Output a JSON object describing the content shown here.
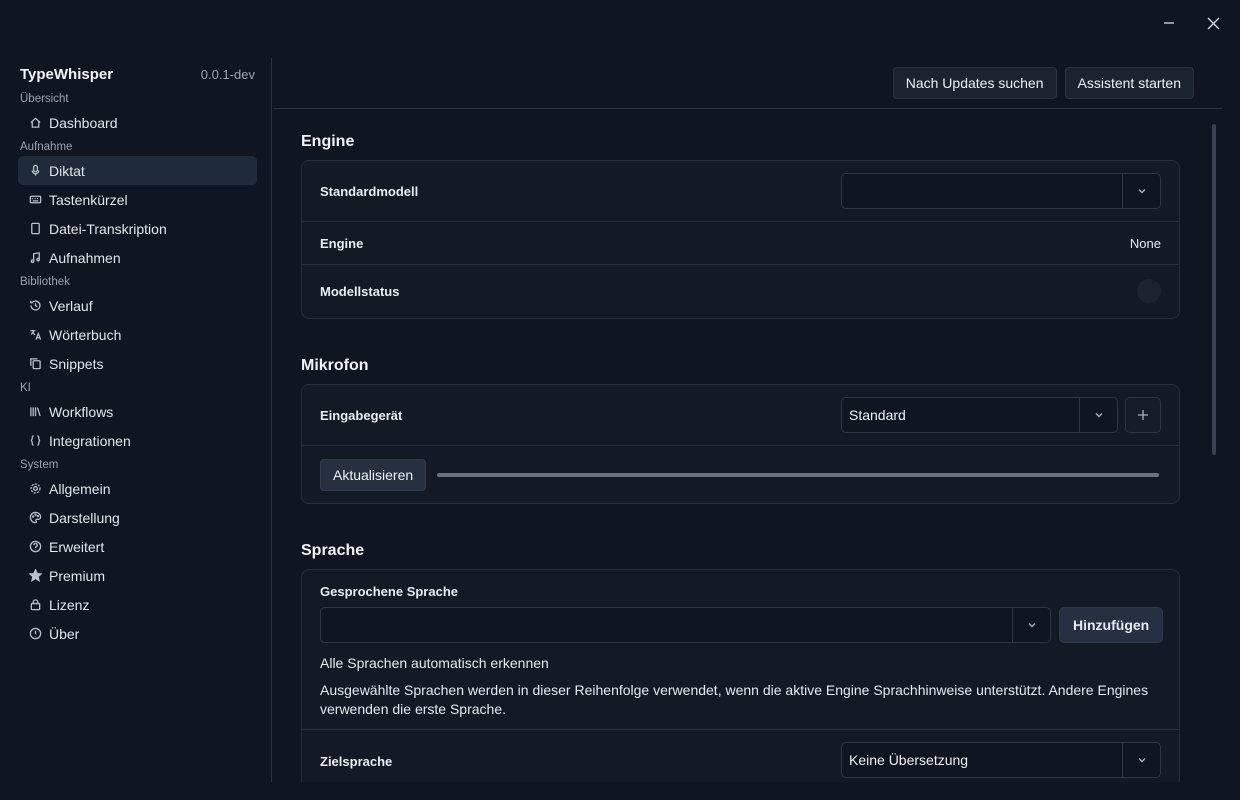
{
  "window": {
    "minimize_icon": "minimize-icon",
    "close_icon": "close-icon"
  },
  "sidebar": {
    "app_name": "TypeWhisper",
    "version": "0.0.1-dev",
    "sections": [
      {
        "title": "Übersicht",
        "items": [
          {
            "label": "Dashboard",
            "icon": "home-icon"
          }
        ]
      },
      {
        "title": "Aufnahme",
        "items": [
          {
            "label": "Diktat",
            "icon": "microphone-icon",
            "active": true
          },
          {
            "label": "Tastenkürzel",
            "icon": "keyboard-icon"
          },
          {
            "label": "Datei-Transkription",
            "icon": "file-icon"
          },
          {
            "label": "Aufnahmen",
            "icon": "music-note-icon"
          }
        ]
      },
      {
        "title": "Bibliothek",
        "items": [
          {
            "label": "Verlauf",
            "icon": "history-icon"
          },
          {
            "label": "Wörterbuch",
            "icon": "translate-icon"
          },
          {
            "label": "Snippets",
            "icon": "copy-icon"
          }
        ]
      },
      {
        "title": "KI",
        "items": [
          {
            "label": "Workflows",
            "icon": "library-icon"
          },
          {
            "label": "Integrationen",
            "icon": "braces-icon"
          }
        ]
      },
      {
        "title": "System",
        "items": [
          {
            "label": "Allgemein",
            "icon": "gear-icon"
          },
          {
            "label": "Darstellung",
            "icon": "palette-icon"
          },
          {
            "label": "Erweitert",
            "icon": "help-circle-icon"
          },
          {
            "label": "Premium",
            "icon": "star-icon"
          },
          {
            "label": "Lizenz",
            "icon": "lock-icon"
          },
          {
            "label": "Über",
            "icon": "info-icon"
          }
        ]
      }
    ]
  },
  "topbar": {
    "updates_button": "Nach Updates suchen",
    "wizard_button": "Assistent starten"
  },
  "engine": {
    "title": "Engine",
    "default_model_label": "Standardmodell",
    "default_model_value": "",
    "engine_label": "Engine",
    "engine_value": "None",
    "model_status_label": "Modellstatus"
  },
  "microphone": {
    "title": "Mikrofon",
    "input_device_label": "Eingabegerät",
    "input_device_value": "Standard",
    "refresh_button": "Aktualisieren",
    "input_level": 0
  },
  "language": {
    "title": "Sprache",
    "spoken_language_label": "Gesprochene Sprache",
    "spoken_language_value": "",
    "add_button": "Hinzufügen",
    "auto_detect_text": "Alle Sprachen automatisch erkennen",
    "hint_text": "Ausgewählte Sprachen werden in dieser Reihenfolge verwendet, wenn die aktive Engine Sprachhinweise unterstützt. Andere Engines verwenden die erste Sprache.",
    "target_language_label": "Zielsprache",
    "target_language_value": "Keine Übersetzung"
  },
  "colors": {
    "background": "#0f1521",
    "card": "#131a26",
    "active_nav": "#1f2a3a",
    "border": "#262d3a"
  }
}
